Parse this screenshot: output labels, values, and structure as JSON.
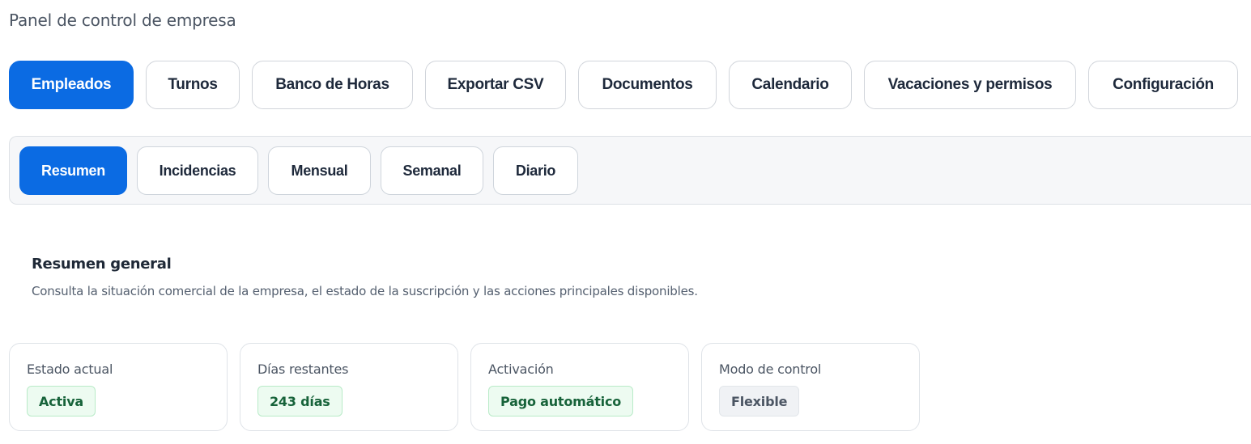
{
  "header": {
    "title": "Panel de control de empresa"
  },
  "main_tabs": [
    {
      "label": "Empleados",
      "active": true
    },
    {
      "label": "Turnos",
      "active": false
    },
    {
      "label": "Banco de Horas",
      "active": false
    },
    {
      "label": "Exportar CSV",
      "active": false
    },
    {
      "label": "Documentos",
      "active": false
    },
    {
      "label": "Calendario",
      "active": false
    },
    {
      "label": "Vacaciones y permisos",
      "active": false
    },
    {
      "label": "Configuración",
      "active": false
    }
  ],
  "sub_tabs": [
    {
      "label": "Resumen",
      "active": true
    },
    {
      "label": "Incidencias",
      "active": false
    },
    {
      "label": "Mensual",
      "active": false
    },
    {
      "label": "Semanal",
      "active": false
    },
    {
      "label": "Diario",
      "active": false
    }
  ],
  "summary": {
    "title": "Resumen general",
    "description": "Consulta la situación comercial de la empresa, el estado de la suscripción y las acciones principales disponibles.",
    "cards": [
      {
        "label": "Estado actual",
        "value": "Activa",
        "tone": "green",
        "tone_color": "#17633a"
      },
      {
        "label": "Días restantes",
        "value": "243 días",
        "tone": "green",
        "tone_color": "#17633a"
      },
      {
        "label": "Activación",
        "value": "Pago automático",
        "tone": "green",
        "tone_color": "#17633a"
      },
      {
        "label": "Modo de control",
        "value": "Flexible",
        "tone": "gray",
        "tone_color": "#4b5563"
      }
    ]
  },
  "colors": {
    "accent": "#0b6be3",
    "success_bg": "#edfbf1",
    "neutral_bg": "#f0f2f5"
  }
}
